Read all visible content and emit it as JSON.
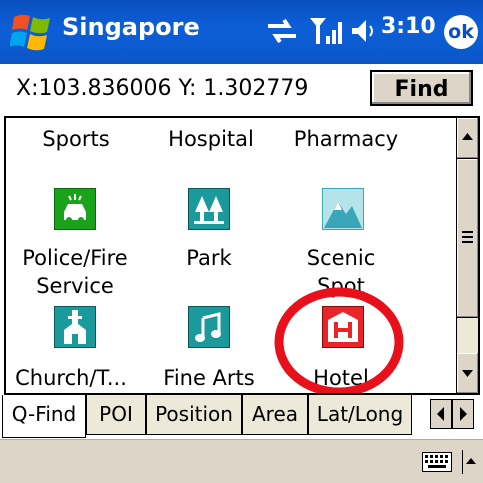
{
  "titlebar": {
    "title": "Singapore",
    "time": "3:10",
    "ok_label": "ok",
    "icons": [
      "windows-start-icon",
      "sync-icon",
      "signal-icon",
      "volume-icon"
    ],
    "bg_color": "#0a4fbf"
  },
  "coords": {
    "text": "X:103.836006 Y: 1.302779",
    "find_label": "Find"
  },
  "categories": {
    "headers": [
      "Sports",
      "Hospital",
      "Pharmacy"
    ],
    "items": [
      {
        "label_line1": "Police/Fire",
        "label_line2": "Service",
        "icon": "police-car-icon",
        "color": "#1aa31a"
      },
      {
        "label_line1": "Park",
        "label_line2": "",
        "icon": "park-trees-icon",
        "color": "#1a9a9a"
      },
      {
        "label_line1": "Scenic",
        "label_line2": "Spot",
        "icon": "mountain-icon",
        "color": "#3aa6b8"
      },
      {
        "label_line1": "Church/T...",
        "label_line2": "",
        "icon": "church-icon",
        "color": "#1a9a9a"
      },
      {
        "label_line1": "Fine Arts",
        "label_line2": "",
        "icon": "music-note-icon",
        "color": "#1a9a9a"
      },
      {
        "label_line1": "Hotel",
        "label_line2": "",
        "icon": "hotel-icon",
        "color": "#e8262a"
      }
    ],
    "highlight_color": "#e8101a"
  },
  "tabs": {
    "items": [
      "Q-Find",
      "POI",
      "Position",
      "Area",
      "Lat/Long"
    ],
    "active": "Q-Find"
  }
}
